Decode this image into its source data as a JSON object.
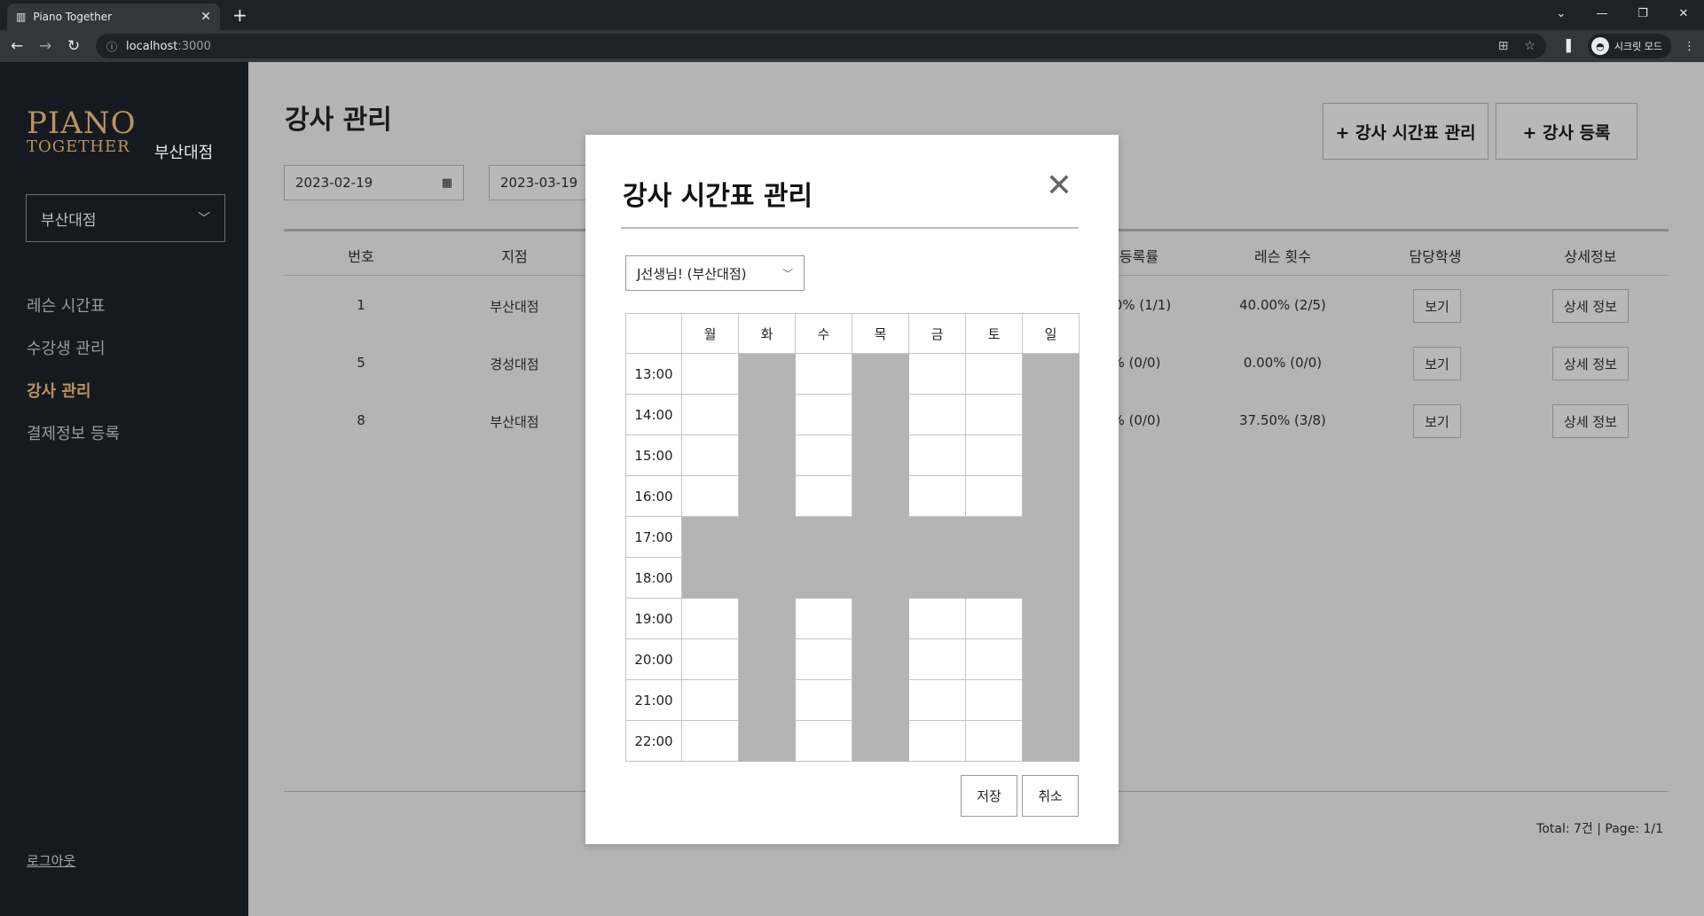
{
  "browser": {
    "tab_title": "Piano Together",
    "url_host": "localhost",
    "url_port": ":3000",
    "profile_label": "시크릿 모드"
  },
  "sidebar": {
    "logo_line1": "PIANO",
    "logo_line2": "TOGETHER",
    "logo_branch": "부산대점",
    "branch_select_value": "부산대점",
    "menu": [
      {
        "label": "레슨 시간표",
        "active": false
      },
      {
        "label": "수강생 관리",
        "active": false
      },
      {
        "label": "강사 관리",
        "active": true
      },
      {
        "label": "결제정보 등록",
        "active": false
      }
    ],
    "logout_label": "로그아웃"
  },
  "main": {
    "title": "강사 관리",
    "buttons": {
      "timetable": "+ 강사 시간표 관리",
      "register": "+ 강사 등록"
    },
    "date_from": "2023-02-19",
    "date_to": "2023-03-19",
    "columns": [
      "번호",
      "지점",
      "등록률",
      "레슨 횟수",
      "담당학생",
      "상세정보"
    ],
    "rows": [
      {
        "no": "1",
        "branch": "부산대점",
        "rate": "0% (1/1)",
        "lessons": "40.00% (2/5)"
      },
      {
        "no": "5",
        "branch": "경성대점",
        "rate": "% (0/0)",
        "lessons": "0.00% (0/0)"
      },
      {
        "no": "8",
        "branch": "부산대점",
        "rate": "% (0/0)",
        "lessons": "37.50% (3/8)"
      }
    ],
    "view_label": "보기",
    "detail_label": "상세 정보",
    "pager": "Total: 7건 | Page: 1/1"
  },
  "modal": {
    "title": "강사 시간표 관리",
    "teacher_select": "J선생님! (부산대점)",
    "days": [
      "월",
      "화",
      "수",
      "목",
      "금",
      "토",
      "일"
    ],
    "times": [
      "13:00",
      "14:00",
      "15:00",
      "16:00",
      "17:00",
      "18:00",
      "19:00",
      "20:00",
      "21:00",
      "22:00"
    ],
    "availability": [
      [
        1,
        0,
        1,
        0,
        1,
        1,
        0
      ],
      [
        1,
        0,
        1,
        0,
        1,
        1,
        0
      ],
      [
        1,
        0,
        1,
        0,
        1,
        1,
        0
      ],
      [
        1,
        0,
        1,
        0,
        1,
        1,
        0
      ],
      [
        0,
        0,
        0,
        0,
        0,
        0,
        0
      ],
      [
        0,
        0,
        0,
        0,
        0,
        0,
        0
      ],
      [
        1,
        0,
        1,
        0,
        1,
        1,
        0
      ],
      [
        1,
        0,
        1,
        0,
        1,
        1,
        0
      ],
      [
        1,
        0,
        1,
        0,
        1,
        1,
        0
      ],
      [
        1,
        0,
        1,
        0,
        1,
        1,
        0
      ]
    ],
    "save_label": "저장",
    "cancel_label": "취소"
  }
}
